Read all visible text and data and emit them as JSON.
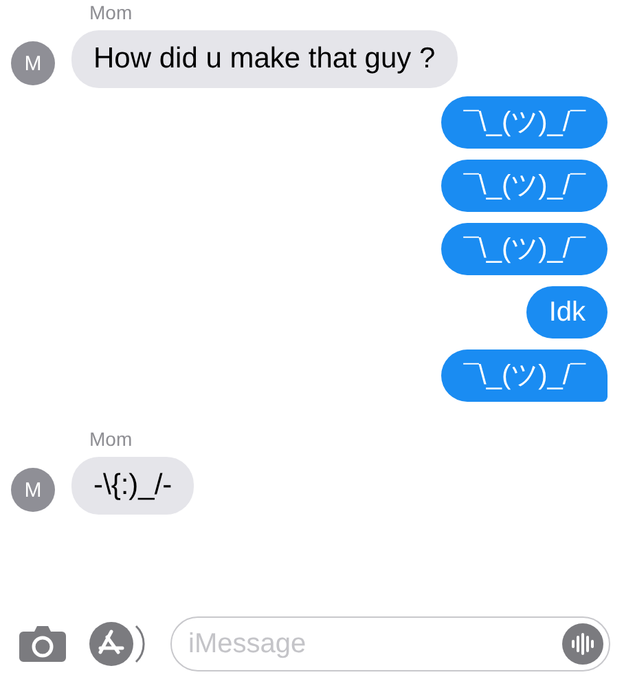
{
  "messages": [
    {
      "kind": "sender",
      "text": "Mom"
    },
    {
      "kind": "incoming",
      "avatar": "M",
      "text": "How did u make that guy ?"
    },
    {
      "kind": "outgoing",
      "text": "¯\\_(ツ)_/¯"
    },
    {
      "kind": "outgoing",
      "text": "¯\\_(ツ)_/¯"
    },
    {
      "kind": "outgoing",
      "text": "¯\\_(ツ)_/¯"
    },
    {
      "kind": "outgoing",
      "text": "Idk"
    },
    {
      "kind": "outgoing",
      "text": "¯\\_(ツ)_/¯",
      "tail": true
    },
    {
      "kind": "sender",
      "text": "Mom"
    },
    {
      "kind": "incoming",
      "avatar": "M",
      "text": "-\\{:)_/-"
    }
  ],
  "composer": {
    "placeholder": "iMessage"
  }
}
